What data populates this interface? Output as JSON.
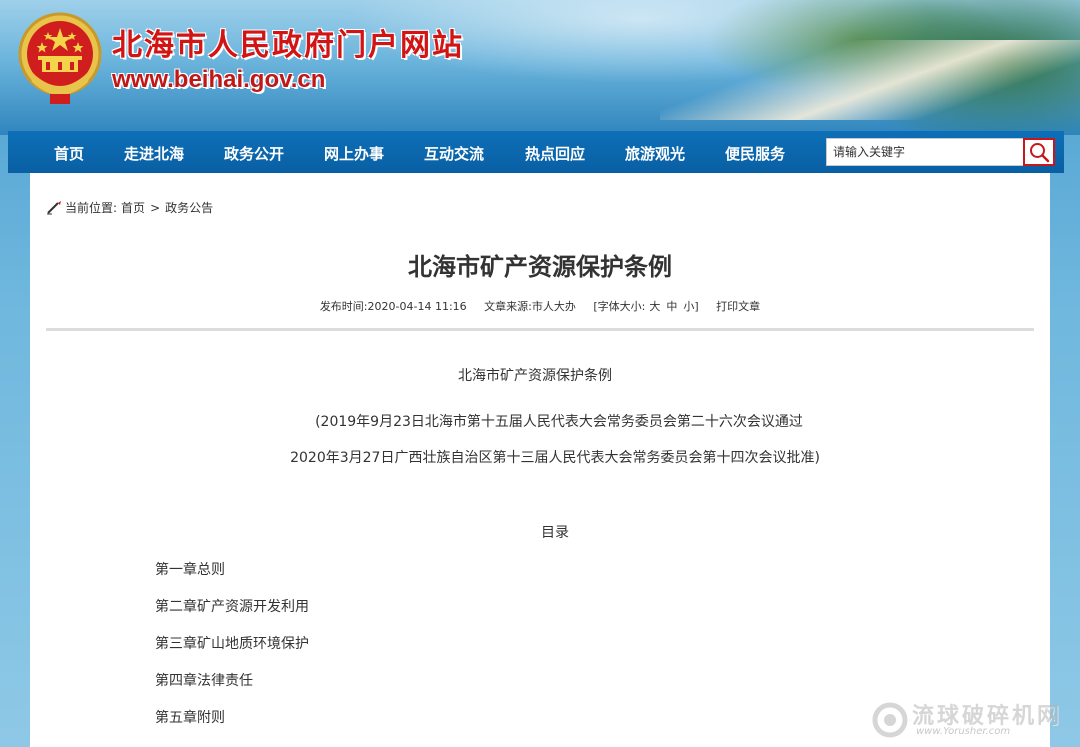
{
  "header": {
    "site_title": "北海市人民政府门户网站",
    "site_url": "www.beihai.gov.cn",
    "emblem_icon": "national-emblem-icon"
  },
  "nav": {
    "items": [
      {
        "label": "首页"
      },
      {
        "label": "走进北海"
      },
      {
        "label": "政务公开"
      },
      {
        "label": "网上办事"
      },
      {
        "label": "互动交流"
      },
      {
        "label": "热点回应"
      },
      {
        "label": "旅游观光"
      },
      {
        "label": "便民服务"
      }
    ],
    "search_placeholder": "请输入关键字",
    "search_icon": "search-icon"
  },
  "breadcrumb": {
    "prefix": "当前位置:",
    "home": "首页",
    "separator": ">",
    "current": "政务公告"
  },
  "article": {
    "title": "北海市矿产资源保护条例",
    "meta": {
      "published": "发布时间:2020-04-14 11:16",
      "source": "文章来源:市人大办",
      "font_size_prefix": "[字体大小:",
      "size_large": "大",
      "size_medium": "中",
      "size_small": "小]",
      "print": "打印文章"
    },
    "doc_title": "北海市矿产资源保护条例",
    "adoption_line_1": "(2019年9月23日北海市第十五届人民代表大会常务委员会第二十六次会议通过",
    "adoption_line_2": "2020年3月27日广西壮族自治区第十三届人民代表大会常务委员会第十四次会议批准)",
    "toc_heading": "目录",
    "toc": [
      "第一章总则",
      "第二章矿产资源开发利用",
      "第三章矿山地质环境保护",
      "第四章法律责任",
      "第五章附则"
    ]
  },
  "watermark": {
    "text": "流球破碎机网",
    "url": "www.Yorusher.com"
  },
  "colors": {
    "nav_bg": "#0a5fa3",
    "title_red": "#d21414",
    "search_border": "#c8161d"
  }
}
